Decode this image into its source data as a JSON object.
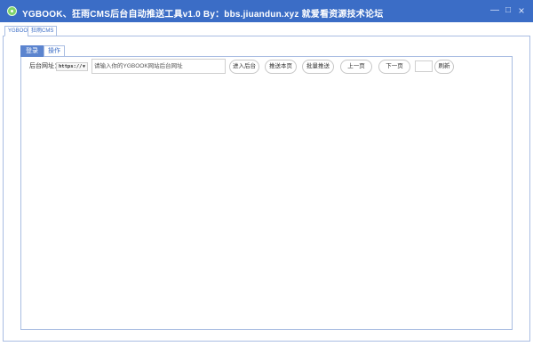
{
  "window": {
    "title": "YGBOOK、狂雨CMS后台自动推送工具v1.0 By：bbs.jiuandun.xyz 就爱看资源技术论坛",
    "minimize": "—",
    "maximize": "□",
    "close": "×"
  },
  "outer_tabs": [
    {
      "label": "YGBOOK"
    },
    {
      "label": "狂雨CMS"
    }
  ],
  "inner_tabs": [
    {
      "label": "登录"
    },
    {
      "label": "操作"
    }
  ],
  "form": {
    "backend_label": "后台网址：",
    "protocol": "https://",
    "url_placeholder": "请输入你的YGBOOK网站后台网址"
  },
  "buttons": {
    "enter_backend": "进入后台",
    "push_this_page": "推送本页",
    "batch_push": "批量推送",
    "prev_page": "上一页",
    "next_page": "下一页",
    "refresh": "刷新"
  }
}
